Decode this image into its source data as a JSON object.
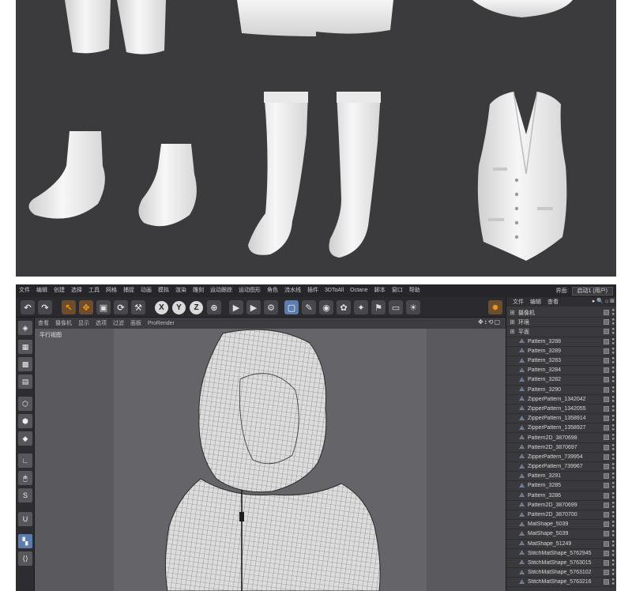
{
  "menu": {
    "items": [
      "文件",
      "编辑",
      "创建",
      "选择",
      "工具",
      "网格",
      "捕捉",
      "动画",
      "模拟",
      "渲染",
      "雕刻",
      "运动跟踪",
      "运动图形",
      "角色",
      "流水线",
      "插件",
      "3DToAll",
      "Octane",
      "脚本",
      "窗口",
      "帮助"
    ],
    "layout_label": "界面:",
    "layout_value": "启动1 (用户)"
  },
  "toolbar": {
    "axis_x": "X",
    "axis_y": "Y",
    "axis_z": "Z"
  },
  "viewport": {
    "menu": [
      "查看",
      "摄像机",
      "显示",
      "选项",
      "过滤",
      "面板",
      "ProRender"
    ],
    "view_label": "平行视图",
    "nav_icons": "✥↕⟲▢"
  },
  "object_manager": {
    "menu": [
      "文件",
      "编辑",
      "查看"
    ],
    "tools": "▸ 🔍 ⌂ ⊞",
    "objects": [
      {
        "name": "摄像机",
        "type": "group"
      },
      {
        "name": "环境",
        "type": "group"
      },
      {
        "name": "平面",
        "type": "group"
      },
      {
        "name": "Pattern_3288",
        "type": "item"
      },
      {
        "name": "Pattern_3289",
        "type": "item"
      },
      {
        "name": "Pattern_3283",
        "type": "item"
      },
      {
        "name": "Pattern_3284",
        "type": "item"
      },
      {
        "name": "Pattern_3282",
        "type": "item"
      },
      {
        "name": "Pattern_3290",
        "type": "item"
      },
      {
        "name": "ZipperPattern_1342042",
        "type": "item"
      },
      {
        "name": "ZipperPattern_1342055",
        "type": "item"
      },
      {
        "name": "ZipperPattern_1358914",
        "type": "item"
      },
      {
        "name": "ZipperPattern_1358927",
        "type": "item"
      },
      {
        "name": "Pattern2D_3870698",
        "type": "item"
      },
      {
        "name": "Pattern2D_3870697",
        "type": "item"
      },
      {
        "name": "ZipperPattern_739954",
        "type": "item"
      },
      {
        "name": "ZipperPattern_739967",
        "type": "item"
      },
      {
        "name": "Pattern_3291",
        "type": "item"
      },
      {
        "name": "Pattern_3285",
        "type": "item"
      },
      {
        "name": "Pattern_3286",
        "type": "item"
      },
      {
        "name": "Pattern2D_3870699",
        "type": "item"
      },
      {
        "name": "Pattern2D_3870700",
        "type": "item"
      },
      {
        "name": "MatShape_5039",
        "type": "item"
      },
      {
        "name": "MatShape_5039",
        "type": "item"
      },
      {
        "name": "MatShape_51249",
        "type": "item"
      },
      {
        "name": "StitchMatShape_5762945",
        "type": "item"
      },
      {
        "name": "StitchMatShape_5763015",
        "type": "item"
      },
      {
        "name": "StitchMatShape_5763102",
        "type": "item"
      },
      {
        "name": "StitchMatShape_5763216",
        "type": "item"
      }
    ]
  },
  "colors": {
    "render_bg": "#3b3b3d",
    "app_bg": "#333336",
    "accent_blue": "#5d7cae",
    "accent_orange": "#f39a25"
  }
}
